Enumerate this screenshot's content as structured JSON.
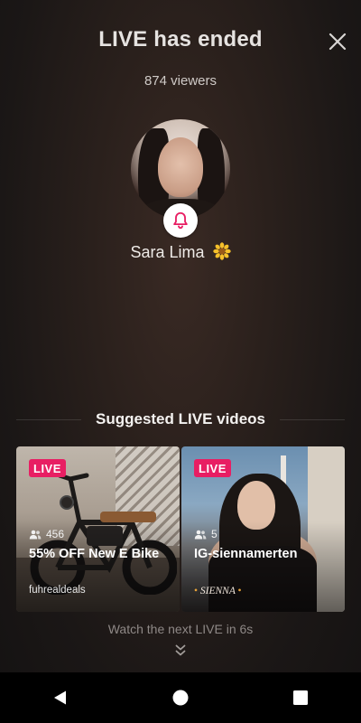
{
  "header": {
    "title": "LIVE has ended",
    "viewers": "874 viewers"
  },
  "host": {
    "name": "Sara Lima"
  },
  "suggested": {
    "heading": "Suggested LIVE videos",
    "cards": [
      {
        "badge": "LIVE",
        "viewer_count": "456",
        "title": "55% OFF New E Bike",
        "subtitle": "fuhrealdeals"
      },
      {
        "badge": "LIVE",
        "viewer_count": "5",
        "title": "IG-siennamerten",
        "subtitle": "SIENNA",
        "subtitle_dot": "•"
      }
    ]
  },
  "footer": {
    "next_live": "Watch the next LIVE in 6s"
  },
  "colors": {
    "live_badge": "#e81e63",
    "bell": "#e81e63"
  },
  "icons": {
    "close": "close-icon",
    "bell": "bell-icon",
    "flower": "sunflower-icon",
    "viewers": "people-icon",
    "chevron": "double-chevron-down-icon",
    "nav_back": "back-triangle-icon",
    "nav_home": "home-circle-icon",
    "nav_recents": "recents-square-icon"
  }
}
